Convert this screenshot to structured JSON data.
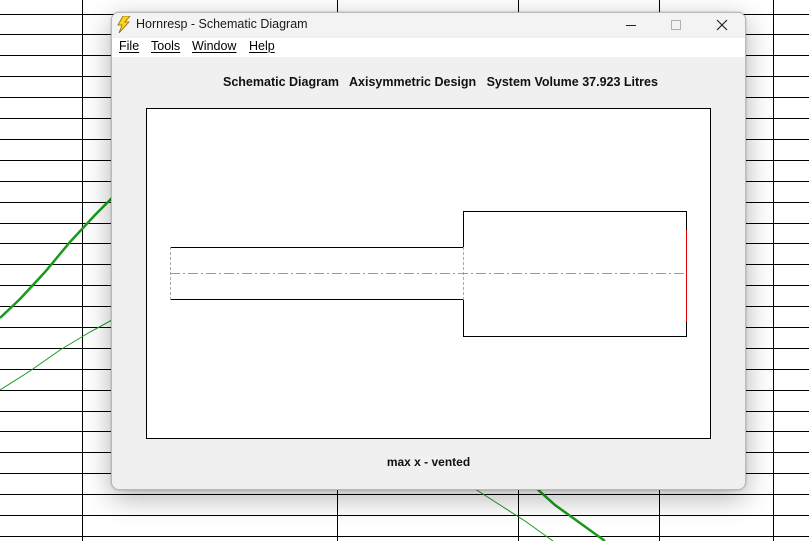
{
  "window": {
    "title": "Hornresp - Schematic Diagram",
    "app_icon": "lightning-bolt-icon",
    "controls": [
      "minimize-icon",
      "maximize-icon",
      "close-icon"
    ]
  },
  "menu": {
    "items": [
      {
        "label": "File"
      },
      {
        "label": "Tools"
      },
      {
        "label": "Window"
      },
      {
        "label": "Help"
      }
    ]
  },
  "diagram": {
    "title": "Schematic Diagram",
    "design": "Axisymmetric Design",
    "system_volume": "System Volume 37.923 Litres",
    "caption": "max x - vented"
  },
  "colors": {
    "plot_line": "#1a9a1a",
    "driver": "#e00000",
    "grid": "#000000"
  }
}
